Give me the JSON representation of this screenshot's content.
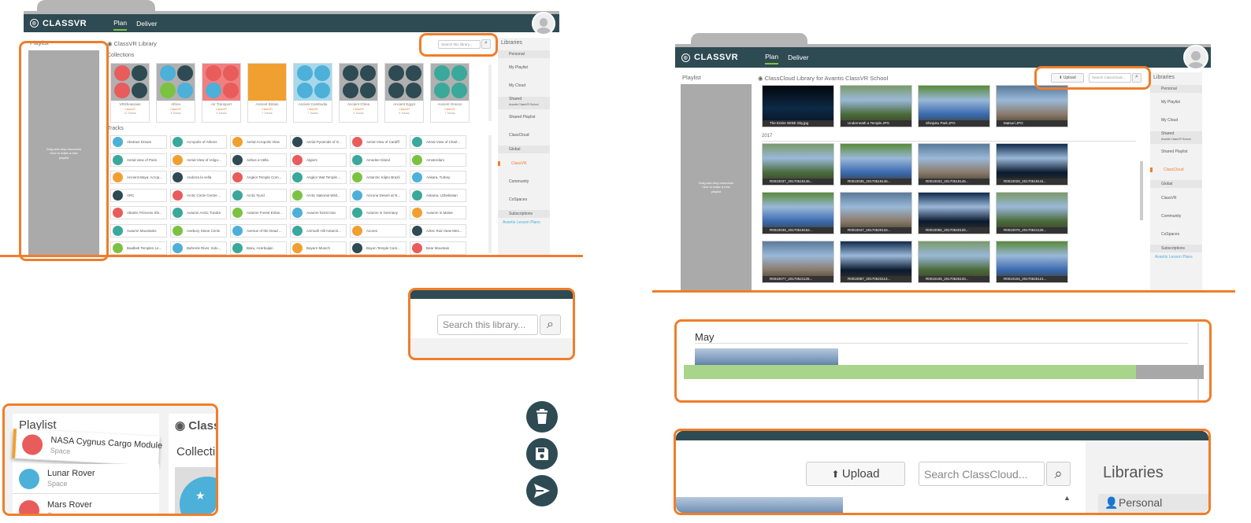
{
  "app": {
    "logo_text": "CLASSVR",
    "nav": [
      "Plan",
      "Deliver"
    ]
  },
  "left_screen": {
    "playlist_title": "Playlist",
    "drop_hint": "Drag and drop resources here to make a new playlist",
    "library_title": "ClassVR Library",
    "search_placeholder": "Search this library...",
    "collections_label": "Collections",
    "tracks_label": "Tracks",
    "collections": [
      {
        "name": "VRShowcase",
        "author": "ClassVR",
        "count": "12 Tracks",
        "colors": [
          "#e85c5c",
          "#2e4a52",
          "#e85c5c",
          "#2e4a52"
        ],
        "bg": "#b0b0b0"
      },
      {
        "name": "Africa",
        "author": "ClassVR",
        "count": "4 Tracks",
        "colors": [
          "#4db0d8",
          "#2e4a52",
          "#7cc242",
          "#4db0d8"
        ],
        "bg": "#b0b0b0"
      },
      {
        "name": "Air Transport",
        "author": "ClassVR",
        "count": "4 Tracks",
        "colors": [
          "#e85c5c",
          "#e85c5c",
          "#4db0d8",
          "#e85c5c"
        ],
        "bg": "#f08080"
      },
      {
        "name": "Ancient Britain",
        "author": "ClassVR",
        "count": "7 Tracks",
        "colors": [
          "#f0a030",
          "#f0a030",
          "#f0a030",
          "#f0a030"
        ],
        "bg": "#f0a030"
      },
      {
        "name": "Ancient Cambodia",
        "author": "ClassVR",
        "count": "7 Tracks",
        "colors": [
          "#4db0d8",
          "#4db0d8",
          "#4db0d8",
          "#4db0d8"
        ],
        "bg": "#a8d8ea"
      },
      {
        "name": "Ancient China",
        "author": "ClassVR",
        "count": "4 Tracks",
        "colors": [
          "#2e4a52",
          "#2e4a52",
          "#2e4a52",
          "#2e4a52"
        ],
        "bg": "#b0b0b0"
      },
      {
        "name": "Ancient Egypt",
        "author": "ClassVR",
        "count": "5 Tracks",
        "colors": [
          "#2e4a52",
          "#2e4a52",
          "#2e4a52",
          "#2e4a52"
        ],
        "bg": "#b0b0b0"
      },
      {
        "name": "Ancient Greece",
        "author": "ClassVR",
        "count": "7 Tracks",
        "colors": [
          "#3aa89a",
          "#3aa89a",
          "#3aa89a",
          "#3aa89a"
        ],
        "bg": "#b0b0b0"
      }
    ],
    "tracks": [
      [
        "Abstract Dream",
        "Acropolis of Athens",
        "Aerial Acropolis View",
        "Aerial Pyramids of G...",
        "Aerial View of Cardiff",
        "Aerial View of Charl..."
      ],
      [
        "Aerial view of Paris",
        "Aerial View of Volgo...",
        "Airbus a-Vella",
        "Algiers",
        "Amedee Island",
        "Amsterdam",
        "Amsterdam Canals"
      ],
      [
        "Ancient Maya: Acrop...",
        "Andorra la vella",
        "Angkor Temple Com...",
        "Angkor Wat Temple ...",
        "Antarctic Kilpto Brazil",
        "Ankara, Turkey"
      ],
      [
        "ARC",
        "Arctic Circle Centre ...",
        "Arctic Fjord",
        "Arctic National Wild...",
        "Arizona Desert at N...",
        "Askana, Uzbekistan"
      ],
      [
        "Atlantic Princess Shi...",
        "Autumn Arctic Tundra",
        "Autumn Forest Enlan...",
        "Autumn forest Iran",
        "Autumn in Germany",
        "Autumn in Maine"
      ],
      [
        "Autumn Mountains",
        "Avebury Stone Circle",
        "Avenue of the Dead ...",
        "Azimuth Hill Antarcti...",
        "Azores",
        "Aztec Ruin New Mex..."
      ],
      [
        "Baalbek Temples Le...",
        "Bahrenk River, Indo...",
        "Baku, Azerbaijan",
        "Bayern Munich",
        "Bayon Temple Cam...",
        "Bear Mountain"
      ]
    ],
    "libraries": {
      "title": "Libraries",
      "personal": "Personal",
      "my_playlist": "My Playlist",
      "my_cloud": "My Cloud",
      "shared": "Shared",
      "shared_sub": "Avantis ClassVR School",
      "shared_playlist": "Shared Playlist",
      "classcloud": "ClassCloud",
      "global": "Global",
      "classvr": "ClassVR",
      "community": "Community",
      "cospaces": "CoSpaces",
      "subscriptions": "Subscriptions",
      "lesson_plans": "Avantis Lesson Plans"
    }
  },
  "right_screen": {
    "playlist_title": "Playlist",
    "drop_hint": "Drag and drop resources here to make a new playlist",
    "library_title": "ClassCloud Library for Avantis ClassVR School",
    "upload_label": "Upload",
    "search_placeholder": "Search ClassCloud...",
    "year_label": "2017",
    "row1": [
      "The Entire WISE Sky.jpg",
      "Underneath a Temple.JPG",
      "Shinjuku Park.JPG",
      "Matsuri.JPG"
    ],
    "row2": [
      "R0010037_20170519145...",
      "R0010035_20170519145...",
      "R0010033_20170519145...",
      "R0010029_20170519141..."
    ],
    "row3": [
      "R0010039_20170519152...",
      "R0010047_20170520134...",
      "R0010055_20170520125...",
      "R0010076_20170521125..."
    ],
    "row4": [
      "R0010077_20170521125...",
      "R0010087_20170523113...",
      "R0010105_20170525133...",
      "R0010104_20170525121..."
    ]
  },
  "zoom_search": {
    "placeholder": "Search this library..."
  },
  "zoom_may": {
    "month_label": "May",
    "progress": 0.87
  },
  "zoom_upload": {
    "upload_label": "Upload",
    "search_placeholder": "Search ClassCloud...",
    "libraries_title": "Libraries",
    "personal_label": "Personal"
  },
  "zoom_playlist": {
    "title": "Playlist",
    "library_partial": "Class",
    "collections_partial": "Collecti",
    "items": [
      {
        "name": "NASA Cygnus Cargo Module",
        "category": "Space",
        "color": "#e85c5c"
      },
      {
        "name": "Lunar Rover",
        "category": "Space",
        "color": "#4db0d8"
      },
      {
        "name": "Mars Rover",
        "category": "Space",
        "color": "#e85c5c"
      }
    ]
  },
  "actions": [
    {
      "icon": "trash-icon",
      "label": "delete"
    },
    {
      "icon": "save-icon",
      "label": "save"
    },
    {
      "icon": "send-icon",
      "label": "send"
    }
  ],
  "colors": {
    "accent": "#f07d2a",
    "navbar": "#2e4a52",
    "green": "#7cc242"
  }
}
